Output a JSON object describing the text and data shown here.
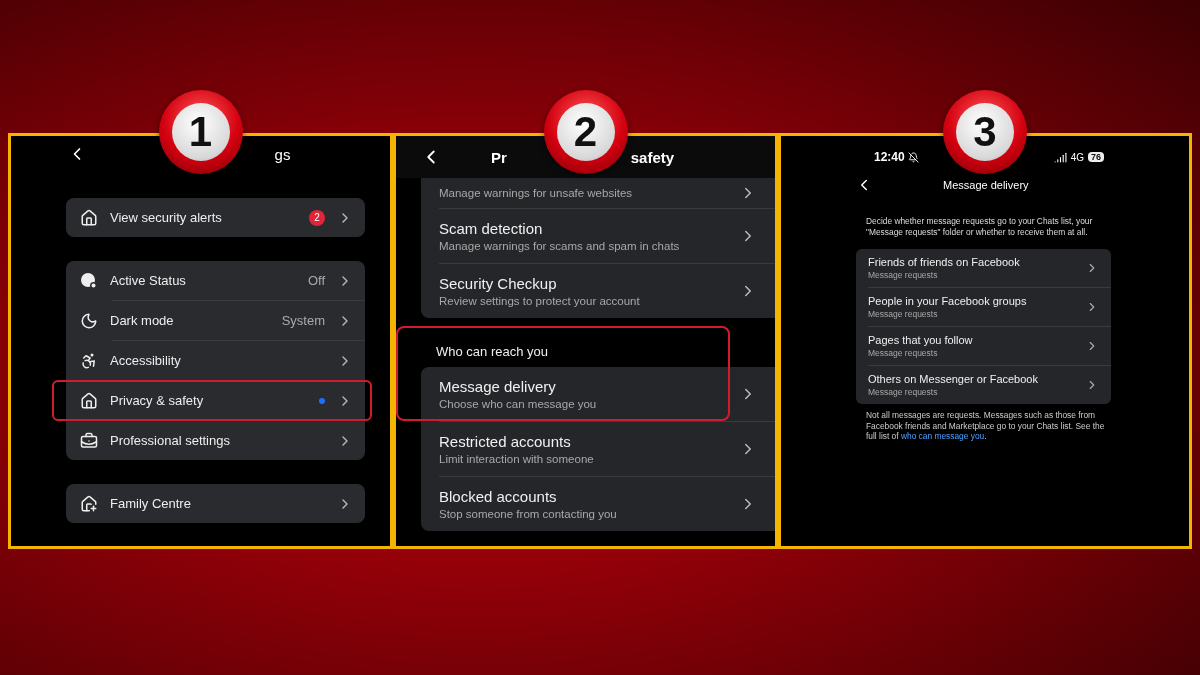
{
  "panels": [
    {
      "kind": "settings",
      "step": "1",
      "title": "gs",
      "groups": [
        {
          "items": [
            {
              "label": "View security alerts",
              "count": "2",
              "dot": false,
              "highlighted": false
            }
          ]
        },
        {
          "items": [
            {
              "label": "Active Status",
              "value": "Off",
              "dot": false,
              "highlighted": false
            },
            {
              "label": "Dark mode",
              "value": "System",
              "dot": false,
              "highlighted": false
            },
            {
              "label": "Accessibility",
              "dot": false,
              "highlighted": false
            },
            {
              "label": "Privacy & safety",
              "dot": true,
              "highlighted": true
            },
            {
              "label": "Professional settings",
              "dot": false,
              "highlighted": false
            }
          ]
        },
        {
          "items": [
            {
              "label": "Family Centre",
              "dot": false,
              "highlighted": false
            }
          ]
        }
      ]
    },
    {
      "kind": "privacy",
      "step": "2",
      "title_parts": [
        "Pr",
        "safety"
      ],
      "sections": [
        {
          "highlighted": false,
          "items": [
            {
              "subtitle": "Manage warnings for unsafe websites"
            },
            {
              "title": "Scam detection",
              "subtitle": "Manage warnings for scams and spam in chats"
            },
            {
              "title": "Security Checkup",
              "subtitle": "Review settings to protect your account"
            }
          ]
        },
        {
          "header": "Who can reach you",
          "highlighted": true,
          "items": [
            {
              "title": "Message delivery",
              "subtitle": "Choose who can message you"
            },
            {
              "title": "Restricted accounts",
              "subtitle": "Limit interaction with someone"
            },
            {
              "title": "Blocked accounts",
              "subtitle": "Stop someone from contacting you"
            }
          ]
        }
      ]
    },
    {
      "kind": "delivery",
      "step": "3",
      "status_bar": {
        "time": "12:40",
        "network": "4G",
        "battery": "76"
      },
      "title": "Message delivery",
      "intro": "Decide whether message requests go to your Chats list, your \"Message requests\" folder or whether to receive them at all.",
      "items": [
        {
          "title": "Friends of friends on Facebook",
          "subtitle": "Message requests"
        },
        {
          "title": "People in your Facebook groups",
          "subtitle": "Message requests"
        },
        {
          "title": "Pages that you follow",
          "subtitle": "Message requests"
        },
        {
          "title": "Others on Messenger or Facebook",
          "subtitle": "Message requests"
        }
      ],
      "footer": {
        "text": "Not all messages are requests. Messages such as those from Facebook friends and Marketplace go to your Chats list. See the full list of ",
        "link": "who can message you",
        "after": "."
      }
    }
  ]
}
